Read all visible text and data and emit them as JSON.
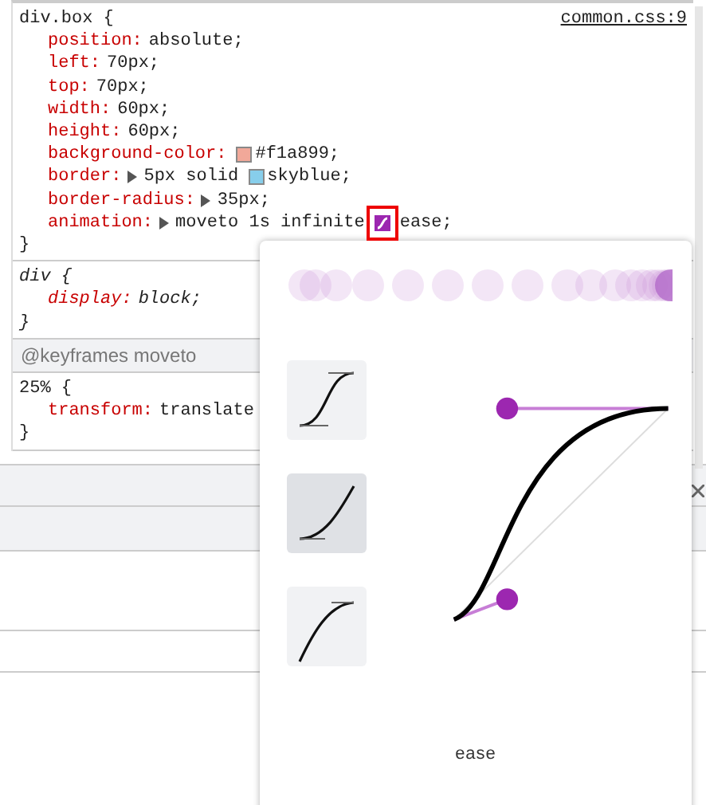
{
  "rules": [
    {
      "selector": "div.box {",
      "source": "common.css:9",
      "italic": false,
      "declarations": [
        {
          "name": "position:",
          "parts": [
            {
              "kind": "text",
              "text": "absolute;"
            }
          ]
        },
        {
          "name": "left:",
          "parts": [
            {
              "kind": "text",
              "text": "70px;"
            }
          ]
        },
        {
          "name": "top:",
          "parts": [
            {
              "kind": "text",
              "text": "70px;"
            }
          ]
        },
        {
          "name": "width:",
          "parts": [
            {
              "kind": "text",
              "text": "60px;"
            }
          ]
        },
        {
          "name": "height:",
          "parts": [
            {
              "kind": "text",
              "text": "60px;"
            }
          ]
        },
        {
          "name": "background-color:",
          "parts": [
            {
              "kind": "swatch",
              "color": "#f1a899"
            },
            {
              "kind": "text",
              "text": "#f1a899;"
            }
          ]
        },
        {
          "name": "border:",
          "parts": [
            {
              "kind": "expander"
            },
            {
              "kind": "text",
              "text": "5px solid"
            },
            {
              "kind": "swatch",
              "color": "#87ceeb"
            },
            {
              "kind": "text",
              "text": "skyblue;"
            }
          ]
        },
        {
          "name": "border-radius:",
          "parts": [
            {
              "kind": "expander"
            },
            {
              "kind": "text",
              "text": "35px;"
            }
          ]
        },
        {
          "name": "animation:",
          "parts": [
            {
              "kind": "expander"
            },
            {
              "kind": "text",
              "text": "moveto 1s infinite"
            },
            {
              "kind": "easing"
            },
            {
              "kind": "text",
              "text": "ease;"
            }
          ]
        }
      ],
      "close": "}"
    },
    {
      "selector": "div {",
      "italic": true,
      "declarations": [
        {
          "name": "display:",
          "parts": [
            {
              "kind": "text",
              "text": "block;"
            }
          ]
        }
      ],
      "close": "}"
    }
  ],
  "keyframes": {
    "header": "@keyframes moveto",
    "selector": "25% {",
    "declarations": [
      {
        "name": "transform:",
        "parts": [
          {
            "kind": "text",
            "text": "translate"
          }
        ]
      }
    ],
    "close": "}"
  },
  "easing_editor": {
    "presets": [
      {
        "kind": "ease-in-out",
        "selected": false
      },
      {
        "kind": "ease-in",
        "selected": true
      },
      {
        "kind": "ease-out",
        "selected": false
      }
    ],
    "curve_label": "ease"
  }
}
